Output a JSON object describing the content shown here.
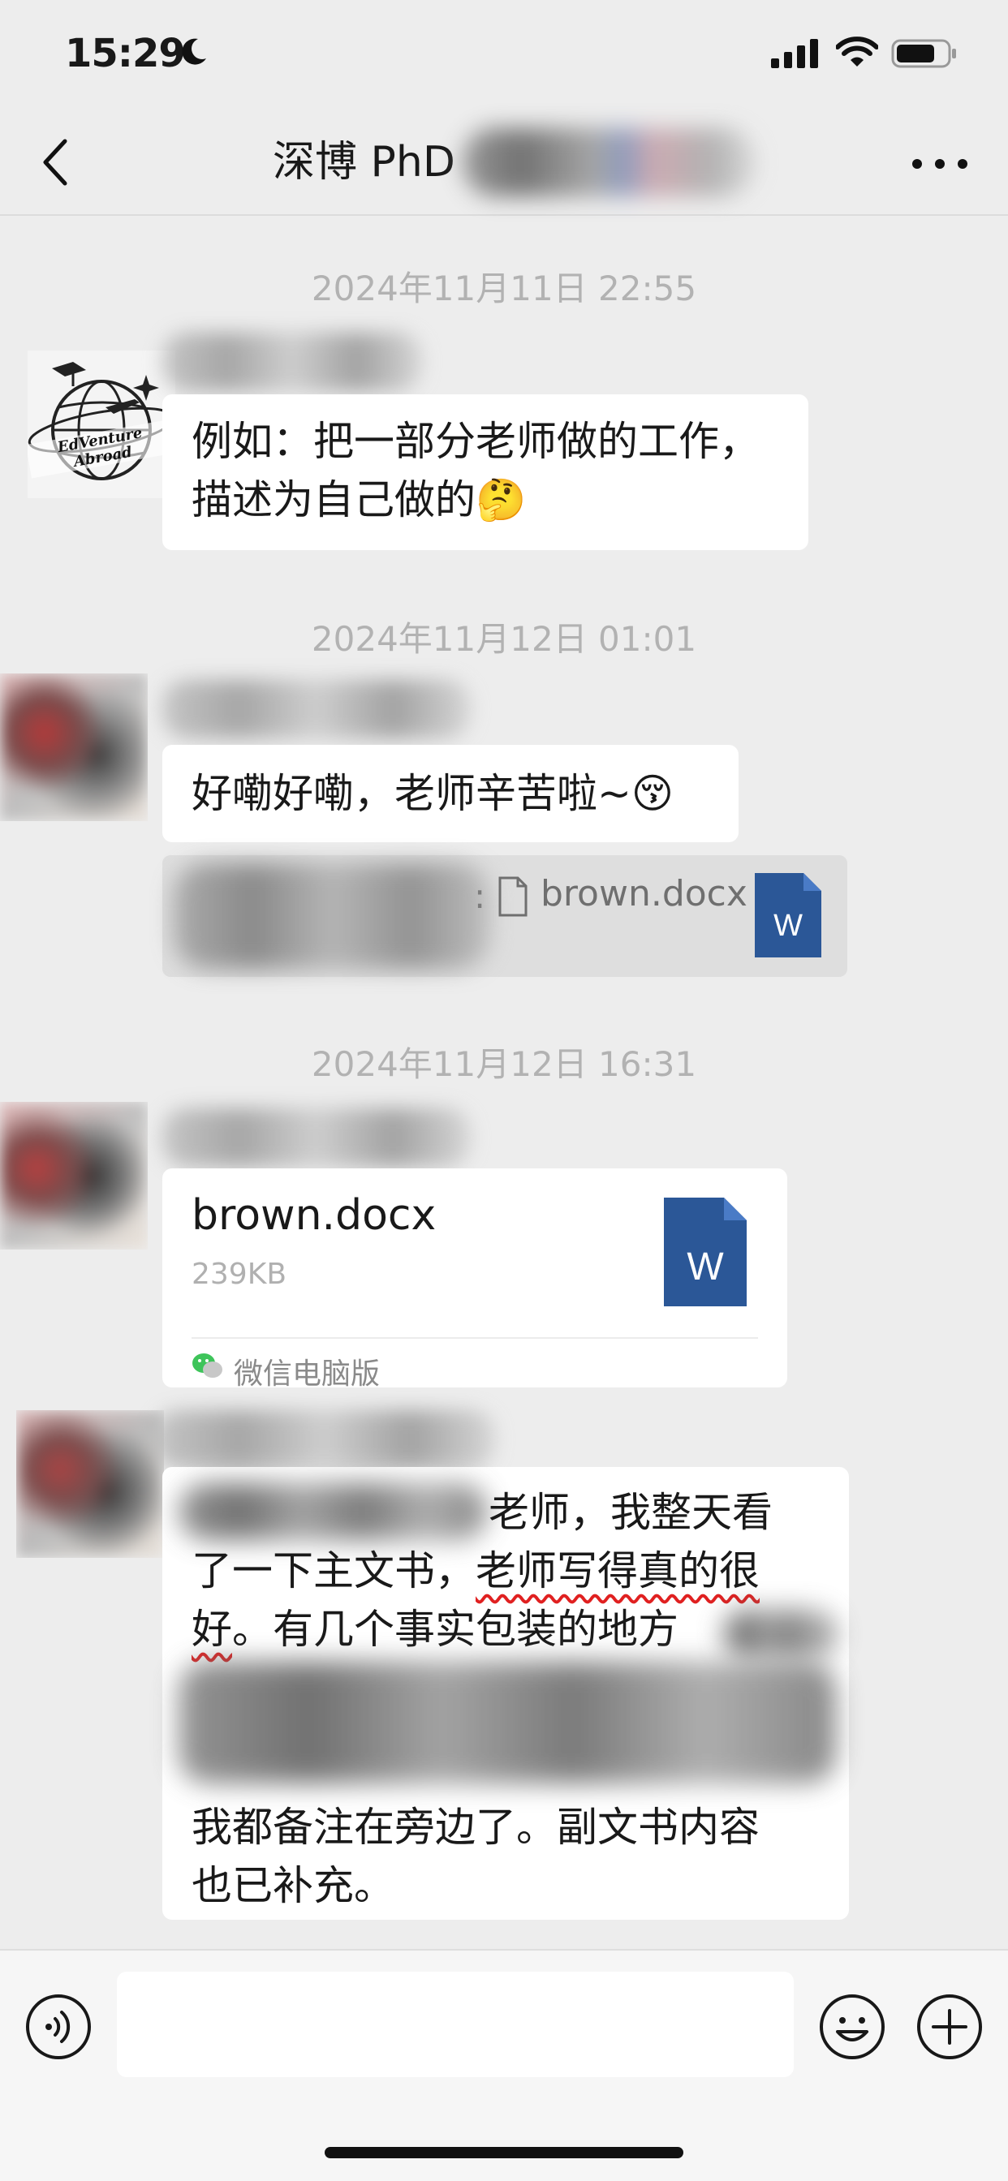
{
  "status_bar": {
    "time": "15:29"
  },
  "nav": {
    "title": "深博 PhD"
  },
  "messages": [
    {
      "timestamp": "2024年11月11日 22:55",
      "text_line1": "例如：把一部分老师做的工作，",
      "text_line2": "描述为自己做的🤔"
    },
    {
      "timestamp": "2024年11月12日 01:01",
      "text": "好嘞好嘞，老师辛苦啦~😚",
      "quote_colon": ":",
      "quote_file": "brown.docx",
      "word_letter": "W"
    },
    {
      "timestamp": "2024年11月12日 16:31",
      "file_name": "brown.docx",
      "file_size": "239KB",
      "file_source": "微信电脑版",
      "word_letter": "W"
    },
    {
      "line1": "老师，我整天看",
      "line2_a": "了一下主文书，",
      "line2_b": "老师写得真的很",
      "line3_a": "好",
      "line3_b": "。有几个事实包装的地方",
      "line5": "我都备注在旁边了。副文书内容",
      "line6": "也已补充。"
    }
  ],
  "avatar1": {
    "logo_text": "EdVenture Abroad"
  },
  "input": {
    "placeholder": ""
  },
  "colors": {
    "background": "#ededed",
    "bubble": "#ffffff",
    "word_blue": "#2b5797",
    "underline": "#e02020"
  }
}
